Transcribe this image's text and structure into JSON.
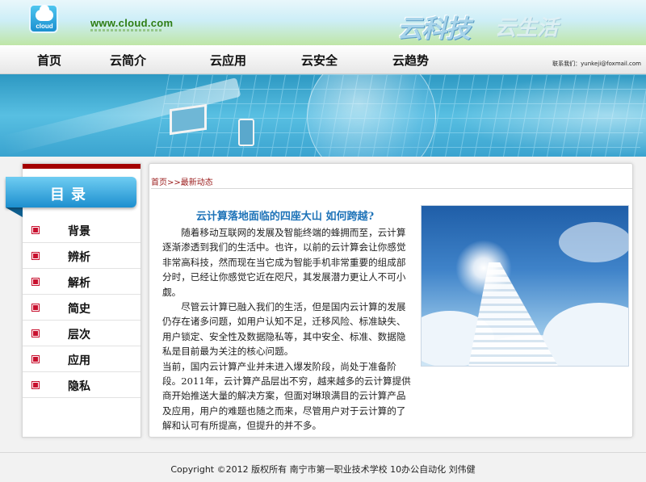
{
  "header": {
    "logo_text": "cloud",
    "site_url": "www.cloud.com",
    "brand_primary": "云科技",
    "brand_secondary": "云生活"
  },
  "nav": {
    "items": [
      {
        "label": "首页"
      },
      {
        "label": "云简介"
      },
      {
        "label": "云应用"
      },
      {
        "label": "云安全"
      },
      {
        "label": "云趋势"
      }
    ],
    "contact": "联系我们：yunkeji@foxmail.com"
  },
  "sidebar": {
    "title": "目录",
    "items": [
      {
        "label": "背景"
      },
      {
        "label": "辨析"
      },
      {
        "label": "解析"
      },
      {
        "label": "简史"
      },
      {
        "label": "层次"
      },
      {
        "label": "应用"
      },
      {
        "label": "隐私"
      }
    ]
  },
  "content": {
    "breadcrumb": "首页>>最新动态",
    "title": "云计算落地面临的四座大山 如何跨越?",
    "paragraphs": [
      "随着移动互联网的发展及智能终端的蜂拥而至，云计算逐渐渗透到我们的生活中。也许，以前的云计算会让你感觉非常高科技，然而现在当它成为智能手机非常重要的组成部分时，已经让你感觉它近在咫尺，其发展潜力更让人不可小觑。",
      "尽管云计算已融入我们的生活，但是国内云计算的发展仍存在诸多问题，如用户认知不足，迁移风险、标准缺失、用户锁定、安全性及数据隐私等，其中安全、标准、数据隐私是目前最为关注的核心问题。",
      "当前，国内云计算产业并未进入爆发阶段，尚处于准备阶段。2011年，云计算产品层出不穷，越来越多的云计算提供商开始推送大量的解决方案，但面对琳琅满目的云计算产品及应用，用户的难题也随之而来，尽管用户对于云计算的了解和认可有所提高，但提升的并不多。"
    ]
  },
  "footer": {
    "text": "Copyright ©2012 版权所有 南宁市第一职业技术学校 10办公自动化 刘伟健"
  },
  "colors": {
    "accent_blue": "#1e73b8",
    "menu_bullet": "#c8102e",
    "breadcrumb": "#9a1b1b",
    "sidebar_top_bar": "#a40000"
  }
}
